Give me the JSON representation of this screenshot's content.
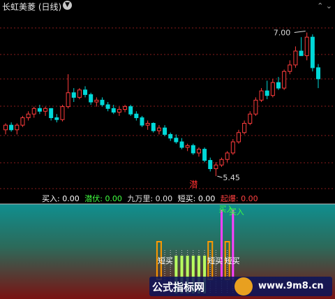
{
  "header": {
    "title": "长虹美菱 (日线)",
    "arrow_icon": "chevron-down-icon",
    "right_icons": [
      "chevron-up-icon",
      "chevron-down-icon"
    ]
  },
  "price_labels": {
    "high": "7.00",
    "low": "5.45",
    "marker": "潜"
  },
  "indicator_bar": {
    "items": [
      {
        "label": "买入:",
        "value": "0.00",
        "color": "#ffffff"
      },
      {
        "label": "潜伏:",
        "value": "0.00",
        "color": "#40ff40"
      },
      {
        "label": "九万里:",
        "value": "0.00",
        "color": "#e0e0e0"
      },
      {
        "label": "短买:",
        "value": "0.00",
        "color": "#ffffff"
      },
      {
        "label": "起爆:",
        "value": "0.00",
        "color": "#ff4040"
      }
    ]
  },
  "signal_labels": {
    "buy": "买入",
    "buy2": "买入",
    "short_buy_1": "短买",
    "short_buy_2": "短买",
    "short_buy_3": "短买"
  },
  "watermark": {
    "text": "公式指标网",
    "url": "www.9m8.cn"
  },
  "colors": {
    "up": "#ff3c3c",
    "down": "#00d8d8",
    "grid": "#8a1c1c",
    "buy": "#40ff40",
    "short_buy": "#ff9900",
    "explode": "#ff40ff",
    "lime": "#b8ff60"
  },
  "chart_data": {
    "type": "candlestick",
    "ylim": [
      5.3,
      7.2
    ],
    "candles": [
      [
        5.95,
        6.02,
        5.9,
        6.0
      ],
      [
        6.0,
        6.03,
        5.93,
        5.95
      ],
      [
        5.95,
        6.02,
        5.9,
        6.0
      ],
      [
        6.0,
        6.1,
        5.98,
        6.08
      ],
      [
        6.08,
        6.15,
        6.05,
        6.12
      ],
      [
        6.12,
        6.2,
        6.08,
        6.18
      ],
      [
        6.18,
        6.22,
        6.12,
        6.15
      ],
      [
        6.15,
        6.2,
        6.1,
        6.18
      ],
      [
        6.18,
        6.16,
        6.05,
        6.08
      ],
      [
        6.08,
        6.12,
        6.03,
        6.06
      ],
      [
        6.06,
        6.22,
        6.04,
        6.2
      ],
      [
        6.2,
        6.55,
        6.18,
        6.35
      ],
      [
        6.35,
        6.4,
        6.25,
        6.3
      ],
      [
        6.3,
        6.4,
        6.28,
        6.38
      ],
      [
        6.38,
        6.42,
        6.3,
        6.33
      ],
      [
        6.33,
        6.35,
        6.22,
        6.25
      ],
      [
        6.25,
        6.3,
        6.2,
        6.27
      ],
      [
        6.27,
        6.3,
        6.2,
        6.22
      ],
      [
        6.22,
        6.25,
        6.15,
        6.18
      ],
      [
        6.18,
        6.22,
        6.12,
        6.14
      ],
      [
        6.14,
        6.2,
        6.1,
        6.17
      ],
      [
        6.17,
        6.22,
        6.14,
        6.2
      ],
      [
        6.2,
        6.22,
        6.1,
        6.12
      ],
      [
        6.12,
        6.15,
        6.05,
        6.08
      ],
      [
        6.08,
        6.1,
        5.98,
        6.0
      ],
      [
        6.0,
        6.05,
        5.95,
        6.02
      ],
      [
        6.02,
        6.03,
        5.92,
        5.94
      ],
      [
        5.94,
        6.0,
        5.9,
        5.97
      ],
      [
        5.97,
        6.0,
        5.88,
        5.9
      ],
      [
        5.9,
        5.92,
        5.83,
        5.86
      ],
      [
        5.86,
        5.9,
        5.8,
        5.82
      ],
      [
        5.82,
        5.86,
        5.74,
        5.76
      ],
      [
        5.76,
        5.8,
        5.72,
        5.78
      ],
      [
        5.78,
        5.8,
        5.68,
        5.7
      ],
      [
        5.7,
        5.76,
        5.66,
        5.74
      ],
      [
        5.74,
        5.76,
        5.6,
        5.62
      ],
      [
        5.62,
        5.65,
        5.5,
        5.53
      ],
      [
        5.53,
        5.6,
        5.45,
        5.57
      ],
      [
        5.57,
        5.65,
        5.55,
        5.63
      ],
      [
        5.63,
        5.72,
        5.6,
        5.7
      ],
      [
        5.7,
        5.85,
        5.68,
        5.82
      ],
      [
        5.82,
        5.95,
        5.8,
        5.92
      ],
      [
        5.92,
        6.05,
        5.9,
        6.02
      ],
      [
        6.02,
        6.15,
        6.0,
        6.12
      ],
      [
        6.12,
        6.3,
        6.1,
        6.27
      ],
      [
        6.27,
        6.4,
        6.25,
        6.37
      ],
      [
        6.37,
        6.48,
        6.28,
        6.32
      ],
      [
        6.32,
        6.5,
        6.3,
        6.46
      ],
      [
        6.46,
        6.52,
        6.38,
        6.4
      ],
      [
        6.4,
        6.6,
        6.38,
        6.58
      ],
      [
        6.58,
        6.7,
        6.55,
        6.65
      ],
      [
        6.65,
        6.85,
        6.62,
        6.8
      ],
      [
        6.8,
        6.95,
        6.75,
        6.75
      ],
      [
        6.75,
        7.0,
        6.7,
        6.95
      ],
      [
        6.95,
        6.98,
        6.58,
        6.62
      ],
      [
        6.62,
        6.66,
        6.4,
        6.5
      ]
    ],
    "signals": {
      "short_buy_index": [
        27,
        36,
        39
      ],
      "explode_index": [
        38,
        40
      ],
      "lime_bars": [
        30,
        31,
        32,
        33,
        34,
        35
      ]
    }
  }
}
